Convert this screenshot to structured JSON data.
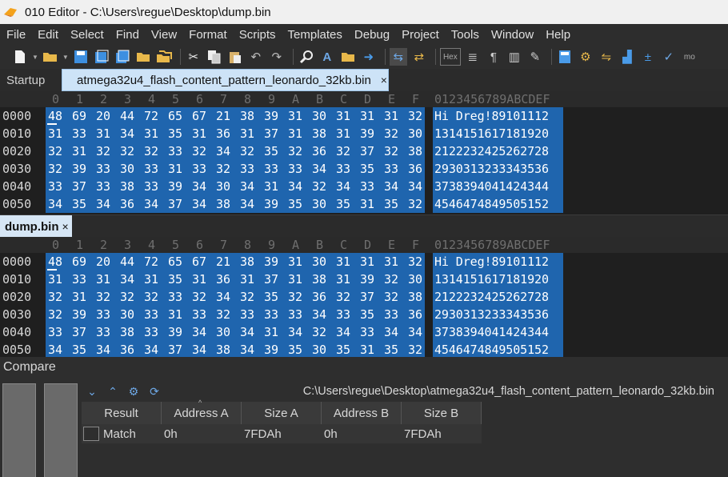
{
  "window": {
    "title": "010 Editor - C:\\Users\\regue\\Desktop\\dump.bin"
  },
  "menu": [
    "File",
    "Edit",
    "Select",
    "Find",
    "View",
    "Format",
    "Scripts",
    "Templates",
    "Debug",
    "Project",
    "Tools",
    "Window",
    "Help"
  ],
  "toolbar": {
    "hex_label": "Hex",
    "more_label": "mo"
  },
  "tabs": {
    "startup": "Startup",
    "active": "atmega32u4_flash_content_pattern_leonardo_32kb.bin",
    "close": "×"
  },
  "hex_header": {
    "columns": [
      "0",
      "1",
      "2",
      "3",
      "4",
      "5",
      "6",
      "7",
      "8",
      "9",
      "A",
      "B",
      "C",
      "D",
      "E",
      "F"
    ],
    "ascii": "0123456789ABCDEF"
  },
  "hex_rows": [
    {
      "addr": "0000",
      "bytes": [
        "48",
        "69",
        "20",
        "44",
        "72",
        "65",
        "67",
        "21",
        "38",
        "39",
        "31",
        "30",
        "31",
        "31",
        "31",
        "32"
      ],
      "ascii": "Hi Dreg!89101112"
    },
    {
      "addr": "0010",
      "bytes": [
        "31",
        "33",
        "31",
        "34",
        "31",
        "35",
        "31",
        "36",
        "31",
        "37",
        "31",
        "38",
        "31",
        "39",
        "32",
        "30"
      ],
      "ascii": "1314151617181920"
    },
    {
      "addr": "0020",
      "bytes": [
        "32",
        "31",
        "32",
        "32",
        "32",
        "33",
        "32",
        "34",
        "32",
        "35",
        "32",
        "36",
        "32",
        "37",
        "32",
        "38"
      ],
      "ascii": "2122232425262728"
    },
    {
      "addr": "0030",
      "bytes": [
        "32",
        "39",
        "33",
        "30",
        "33",
        "31",
        "33",
        "32",
        "33",
        "33",
        "33",
        "34",
        "33",
        "35",
        "33",
        "36"
      ],
      "ascii": "2930313233343536"
    },
    {
      "addr": "0040",
      "bytes": [
        "33",
        "37",
        "33",
        "38",
        "33",
        "39",
        "34",
        "30",
        "34",
        "31",
        "34",
        "32",
        "34",
        "33",
        "34",
        "34"
      ],
      "ascii": "3738394041424344"
    },
    {
      "addr": "0050",
      "bytes": [
        "34",
        "35",
        "34",
        "36",
        "34",
        "37",
        "34",
        "38",
        "34",
        "39",
        "35",
        "30",
        "35",
        "31",
        "35",
        "32"
      ],
      "ascii": "4546474849505152"
    }
  ],
  "file_tab": {
    "label": "dump.bin",
    "close": "×"
  },
  "compare": {
    "title": "Compare",
    "path": "C:\\Users\\regue\\Desktop\\atmega32u4_flash_content_pattern_leonardo_32kb.bin",
    "columns": [
      "Result",
      "Address A",
      "Size A",
      "Address B",
      "Size B"
    ],
    "rows": [
      {
        "result": "Match",
        "address_a": "0h",
        "size_a": "7FDAh",
        "address_b": "0h",
        "size_b": "7FDAh"
      }
    ]
  },
  "colors": {
    "selection": "#1f65ae",
    "active_tab": "#cde3f7",
    "background": "#1f1f1f"
  }
}
